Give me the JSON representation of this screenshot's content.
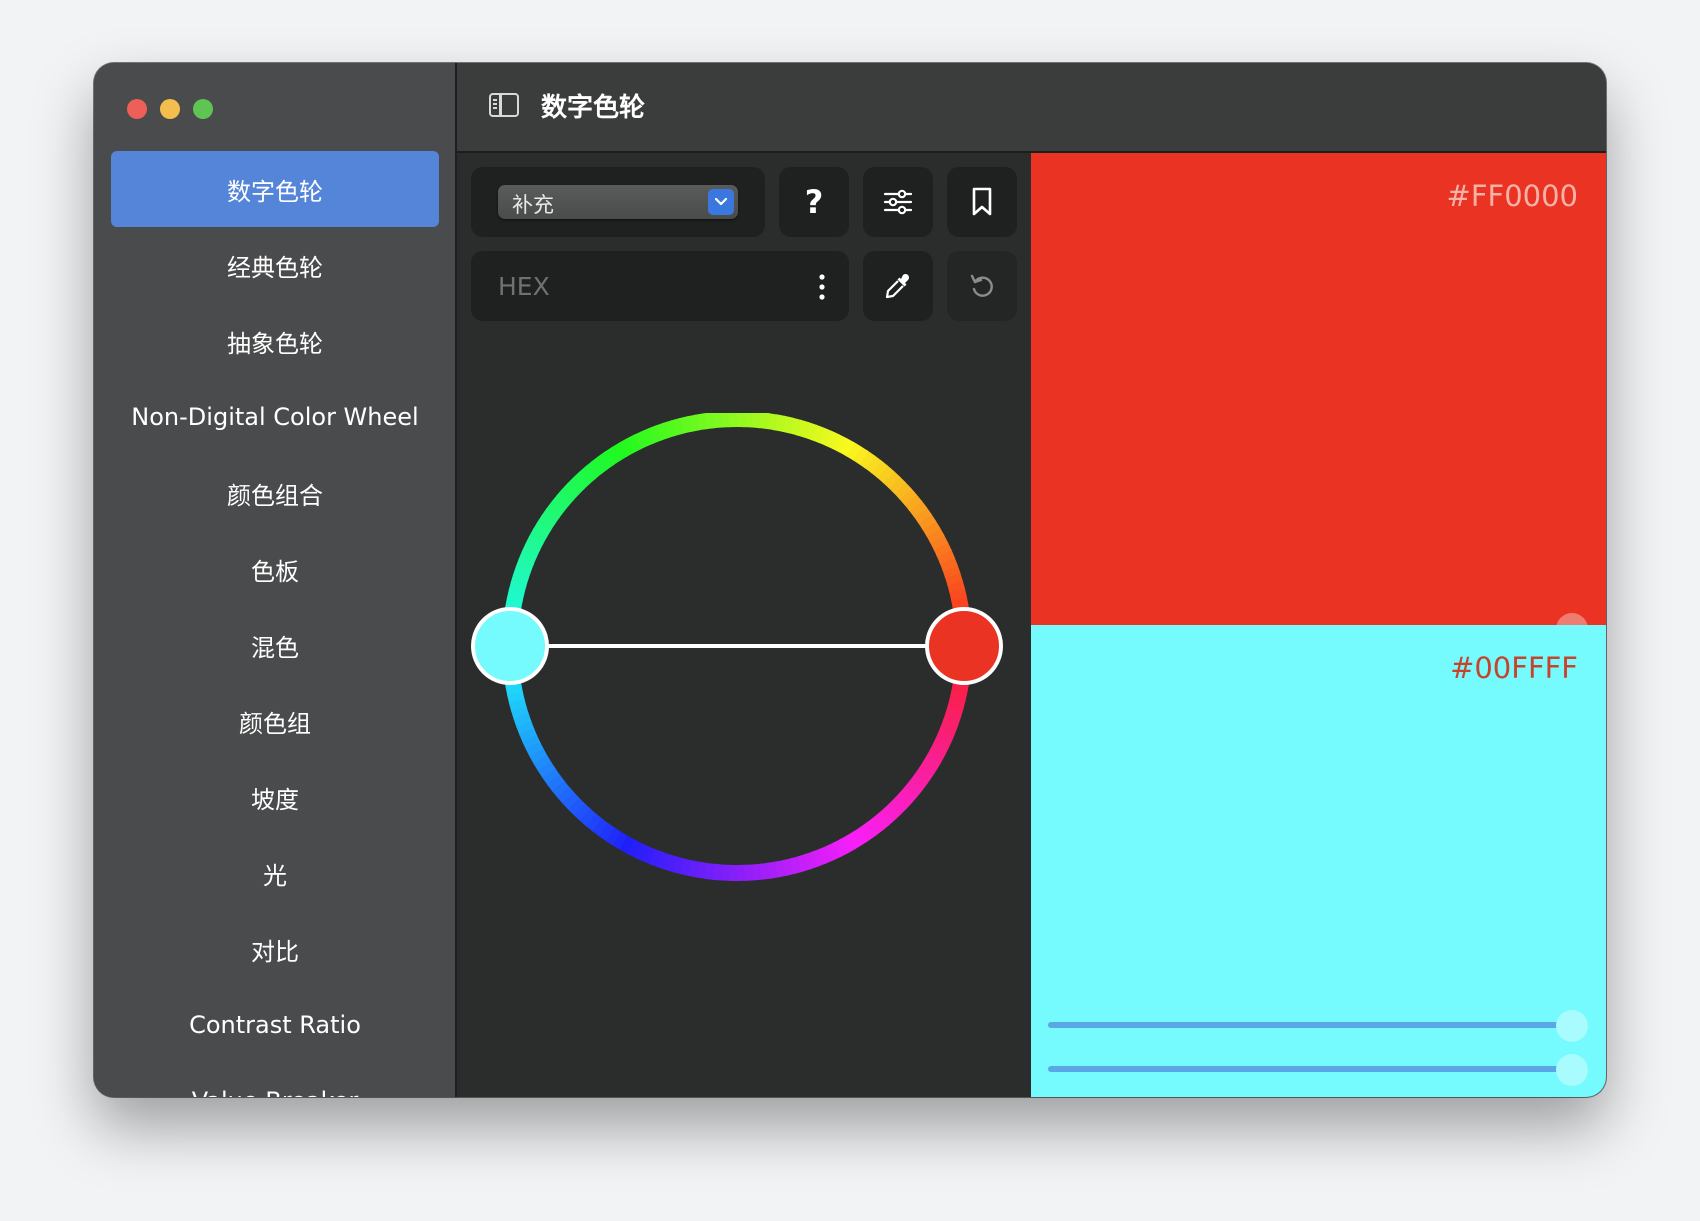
{
  "window": {
    "title": "数字色轮"
  },
  "sidebar": {
    "items": [
      {
        "label": "数字色轮",
        "active": true
      },
      {
        "label": "经典色轮"
      },
      {
        "label": "抽象色轮"
      },
      {
        "label": "Non-Digital Color Wheel"
      },
      {
        "label": "颜色组合"
      },
      {
        "label": "色板"
      },
      {
        "label": "混色"
      },
      {
        "label": "颜色组"
      },
      {
        "label": "坡度"
      },
      {
        "label": "光"
      },
      {
        "label": "对比"
      },
      {
        "label": "Contrast Ratio"
      },
      {
        "label": "Value Breaker"
      }
    ]
  },
  "toolbar": {
    "harmony_select": {
      "value": "补充"
    },
    "help_label": "?",
    "hex_input": {
      "placeholder": "HEX",
      "value": ""
    }
  },
  "icons": {
    "traffic_lights": [
      "close-icon",
      "minimize-icon",
      "zoom-icon"
    ],
    "sidebar_toggle": "sidebar-toggle-icon",
    "select_arrow": "chevron-down-icon",
    "help": "question-icon",
    "adjust": "sliders-icon",
    "save": "bookmark-icon",
    "more": "more-vertical-icon",
    "picker": "eyedropper-icon",
    "reset": "rotate-ccw-icon"
  },
  "colors": {
    "accent": "#5585d8",
    "primary": "#FF0000",
    "complement": "#00FFFF"
  },
  "swatches": [
    {
      "hex": "#FF0000",
      "color": "#ea3323",
      "slider_values": [
        1.0,
        1.0
      ]
    },
    {
      "hex": "#00FFFF",
      "color": "#75fbfd",
      "slider_values": [
        1.0,
        1.0
      ]
    }
  ]
}
